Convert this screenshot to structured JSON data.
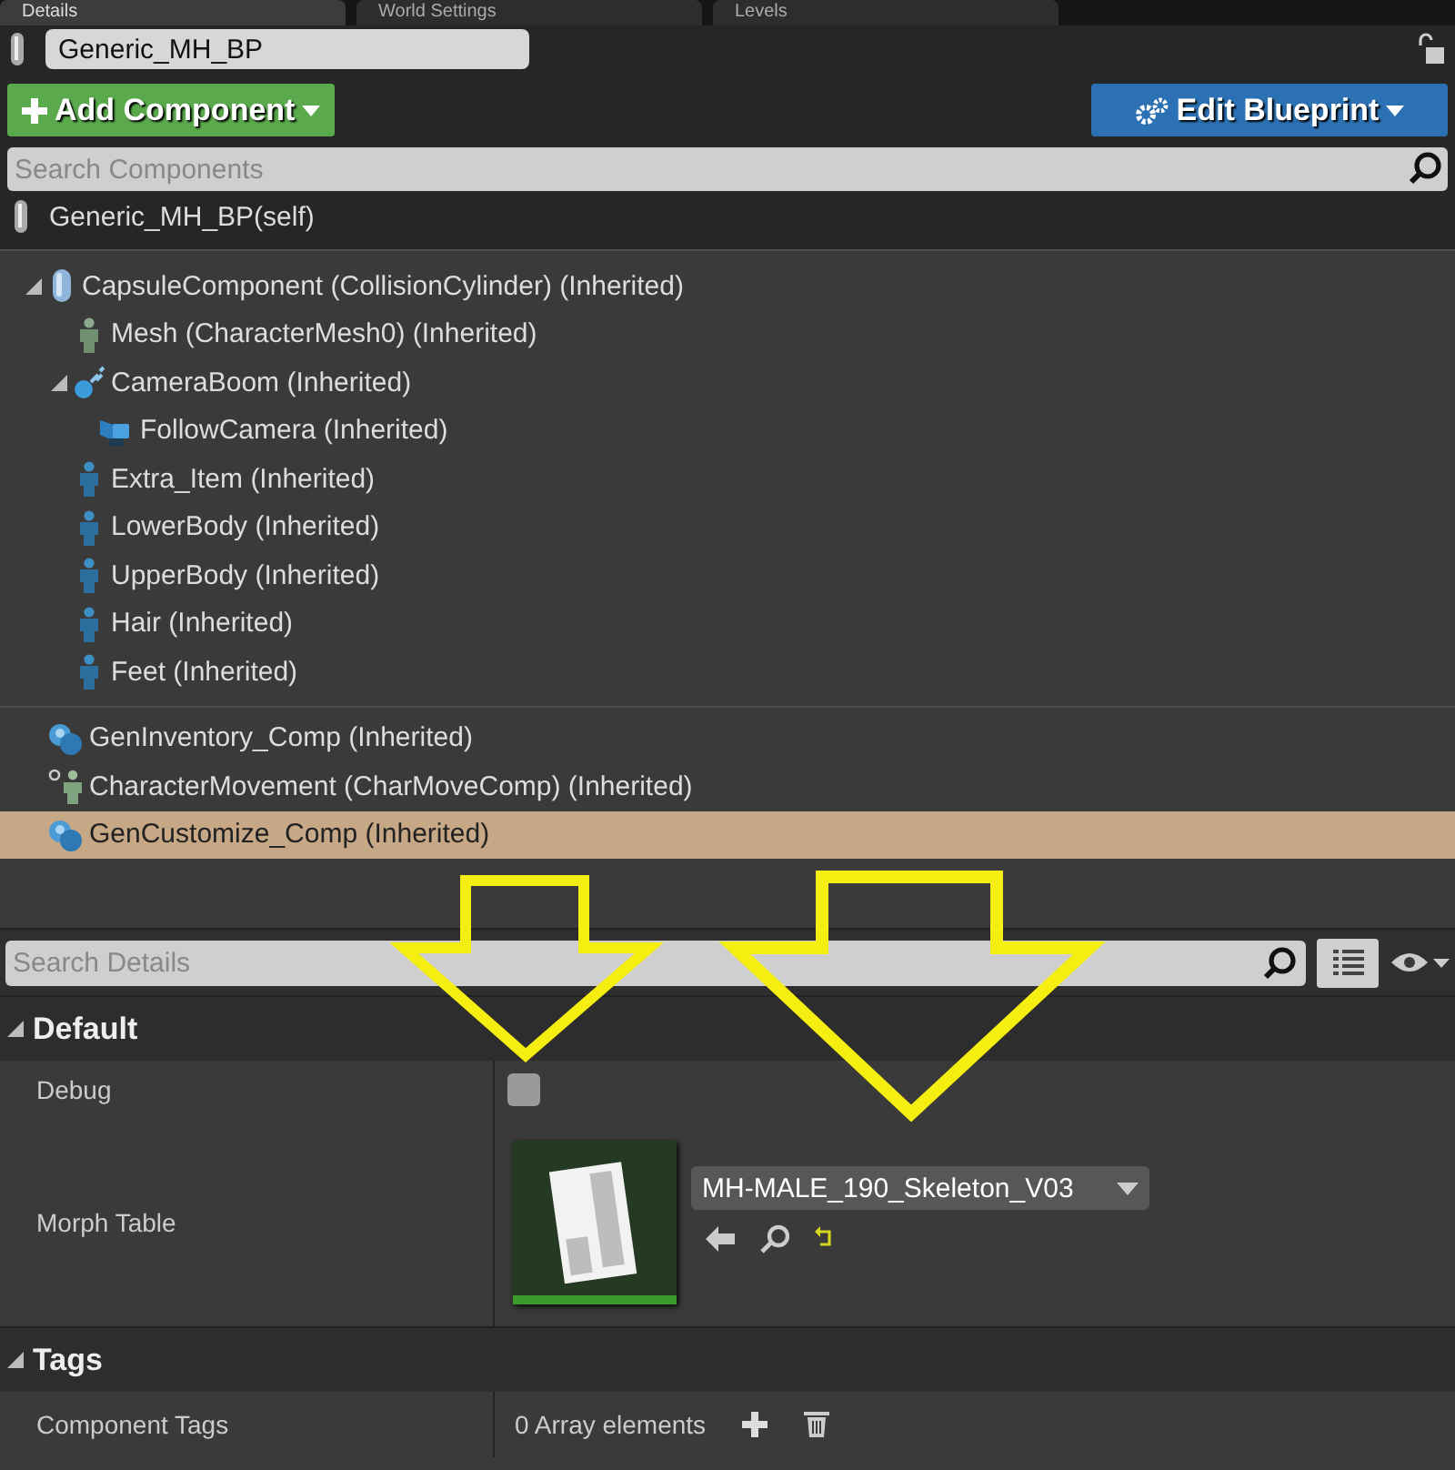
{
  "tabs": [
    {
      "label": "Details",
      "selected": true
    },
    {
      "label": "World Settings",
      "selected": false
    },
    {
      "label": "Levels",
      "selected": false
    }
  ],
  "actor_name": {
    "value": "Generic_MH_BP"
  },
  "add_component_button": {
    "label": "Add Component"
  },
  "edit_blueprint_button": {
    "label": "Edit Blueprint"
  },
  "component_search": {
    "placeholder": "Search Components"
  },
  "self_row": {
    "label": "Generic_MH_BP(self)"
  },
  "component_groups": [
    [
      {
        "label": "CapsuleComponent (CollisionCylinder) (Inherited)",
        "kind": "capsule",
        "selected": false,
        "expanded": true,
        "children": [
          {
            "label": "Mesh (CharacterMesh0) (Inherited)",
            "kind": "mesh",
            "selected": false
          },
          {
            "label": "CameraBoom (Inherited)",
            "kind": "boom",
            "selected": false,
            "expanded": true,
            "children": [
              {
                "label": "FollowCamera (Inherited)",
                "kind": "camera",
                "selected": false
              }
            ]
          },
          {
            "label": "Extra_Item (Inherited)",
            "kind": "skeletal",
            "selected": false
          },
          {
            "label": "LowerBody (Inherited)",
            "kind": "skeletal",
            "selected": false
          },
          {
            "label": "UpperBody (Inherited)",
            "kind": "skeletal",
            "selected": false
          },
          {
            "label": "Hair (Inherited)",
            "kind": "skeletal",
            "selected": false
          },
          {
            "label": "Feet (Inherited)",
            "kind": "skeletal",
            "selected": false
          }
        ]
      }
    ],
    [
      {
        "label": "GenInventory_Comp (Inherited)",
        "kind": "component",
        "selected": false
      },
      {
        "label": "CharacterMovement (CharMoveComp) (Inherited)",
        "kind": "movement",
        "selected": false
      },
      {
        "label": "GenCustomize_Comp (Inherited)",
        "kind": "component",
        "selected": true
      }
    ]
  ],
  "details_search": {
    "placeholder": "Search Details"
  },
  "sections": [
    {
      "title": "Default",
      "expanded": true,
      "properties": [
        {
          "kind": "checkbox",
          "label": "Debug",
          "checked": false
        },
        {
          "kind": "asset",
          "label": "Morph Table",
          "value": "MH-MALE_190_Skeleton_V03"
        }
      ]
    },
    {
      "title": "Tags",
      "expanded": true,
      "properties": [
        {
          "kind": "array",
          "label": "Component Tags",
          "value": "0 Array elements"
        }
      ]
    }
  ]
}
